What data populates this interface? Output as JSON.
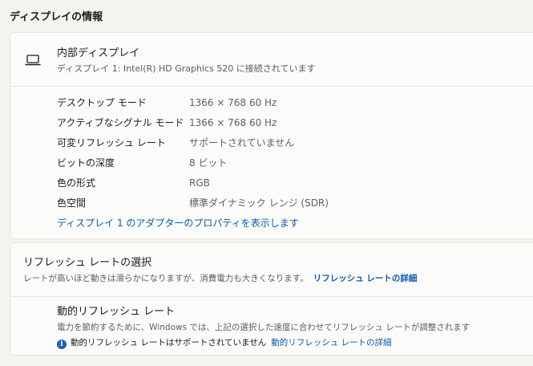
{
  "section_title": "ディスプレイの情報",
  "display": {
    "icon": "laptop-icon",
    "title": "内部ディスプレイ",
    "subtitle": "ディスプレイ 1: Intel(R) HD Graphics 520 に接続されています",
    "properties": [
      {
        "label": "デスクトップ モード",
        "value": "1366 × 768 60 Hz"
      },
      {
        "label": "アクティブなシグナル モード",
        "value": "1366 × 768 60 Hz"
      },
      {
        "label": "可変リフレッシュ レート",
        "value": "サポートされていません"
      },
      {
        "label": "ビットの深度",
        "value": "8 ビット"
      },
      {
        "label": "色の形式",
        "value": "RGB"
      },
      {
        "label": "色空間",
        "value": "標準ダイナミック レンジ (SDR)"
      }
    ],
    "adapter_link": "ディスプレイ 1 のアダプターのプロパティを表示します"
  },
  "refresh": {
    "title": "リフレッシュ レートの選択",
    "description": "レートが高いほど動きは滑らかになりますが、消費電力も大きくなります。",
    "link": "リフレッシュ レートの詳細"
  },
  "dynamic": {
    "title": "動的リフレッシュ レート",
    "description": "電力を節約するために、Windows では、上記の選択した速度に合わせてリフレッシュ レートが調整されます",
    "note": "動的リフレッシュ レートはサポートされていません",
    "link": "動的リフレッシュ レートの詳細",
    "info_icon": "info-icon"
  },
  "colors": {
    "link": "#0f58a8",
    "background": "#f2f5ee",
    "card": "#fbfcf9"
  }
}
